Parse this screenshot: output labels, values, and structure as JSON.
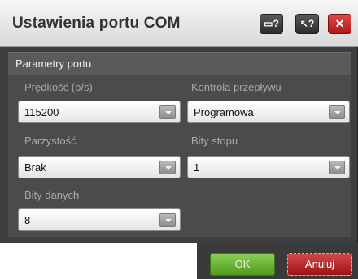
{
  "window": {
    "title": "Ustawienia portu COM",
    "buttons": {
      "help_label": "▭?",
      "context_help_label": "↖?",
      "close_label": "✕"
    }
  },
  "section": {
    "title": "Parametry portu"
  },
  "fields": {
    "speed": {
      "label": "Prędkość (b/s)",
      "value": "115200"
    },
    "flow_control": {
      "label": "Kontrola przepływu",
      "value": "Programowa"
    },
    "parity": {
      "label": "Parzystość",
      "value": "Brak"
    },
    "stop_bits": {
      "label": "Bity stopu",
      "value": "1"
    },
    "data_bits": {
      "label": "Bity danych",
      "value": "8"
    }
  },
  "footer": {
    "ok_label": "OK",
    "cancel_label": "Anuluj"
  },
  "colors": {
    "accent_ok": "#5fae2c",
    "accent_cancel": "#b81e1e",
    "close_button": "#c42222"
  }
}
